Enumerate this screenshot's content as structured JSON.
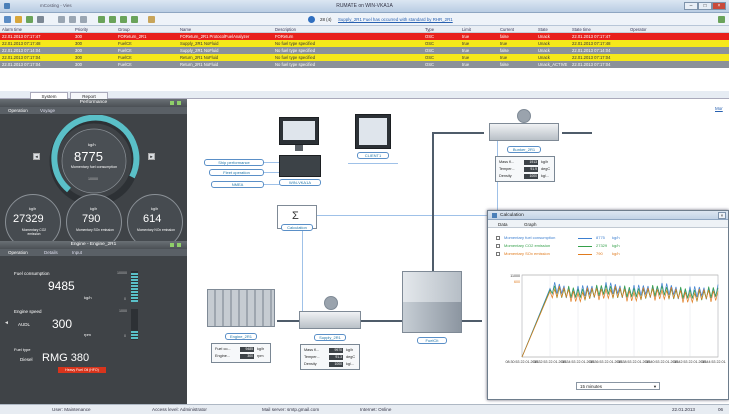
{
  "window": {
    "title": "RUMATE on WIN-VKA1A",
    "app_label": "mCosting - Vies"
  },
  "alarms": {
    "columns": [
      "Alarm time",
      "Priority",
      "Group",
      "Name",
      "Description",
      "Type",
      "Limit",
      "Current",
      "State",
      "State time",
      "Operator"
    ],
    "info_count": "28 (4)",
    "info_text": "Supply_2R1 Fuel has occurred with standard by RHR_2R1",
    "rows": [
      {
        "cells": [
          "22.01.2013 07:17:47",
          "300",
          "FOReturn_2R1",
          "FOReturn_2R1 ProtocolFuelAnalyzer",
          "FOReturn",
          "OSC",
          "true",
          "false",
          "Unack",
          "22.01.2013 07:17:47",
          ""
        ],
        "color": "#e8201c",
        "text": "#fff"
      },
      {
        "cells": [
          "22.01.2013 07:17:48",
          "300",
          "FuelCIt",
          "Supply_2R1 NoFluid",
          "No fuel type specified",
          "OSC",
          "true",
          "true",
          "Unack",
          "22.01.2013 07:17:48",
          ""
        ],
        "color": "#f5e81a",
        "text": "#333"
      },
      {
        "cells": [
          "22.01.2013 07:14:04",
          "300",
          "FuelCIt",
          "Supply_2R1 NoFluid",
          "No fuel type specified",
          "OSC",
          "true",
          "false",
          "Unack",
          "22.01.2013 07:14:04",
          ""
        ],
        "color": "#8b9199",
        "text": "#fff"
      },
      {
        "cells": [
          "22.01.2013 07:17:04",
          "300",
          "FuelCIt",
          "Return_2R1 NoFluid",
          "No fuel type specified",
          "OSC",
          "true",
          "true",
          "Unack",
          "22.01.2013 07:17:04",
          ""
        ],
        "color": "#f5e81a",
        "text": "#333"
      },
      {
        "cells": [
          "22.01.2013 07:17:04",
          "300",
          "FuelCIt",
          "Return_2R1 NoFluid",
          "No fuel type specified",
          "OSC",
          "true",
          "false",
          "Unack_ACTIVE",
          "22.01.2013 07:17:04",
          ""
        ],
        "color": "#8b9199",
        "text": "#fff"
      }
    ]
  },
  "tabs": [
    "System",
    "Report"
  ],
  "performance": {
    "title": "Performance",
    "subtabs": [
      "Operation",
      "Voyage"
    ],
    "center_unit": "kg/h",
    "center_value": "8775",
    "center_label": "Momentary fuel consumption",
    "gauge_max": "10000",
    "cards": [
      {
        "unit": "kg/h",
        "value": "27329",
        "label": "Momentary CO2 emission"
      },
      {
        "unit": "kg/h",
        "value": "790",
        "label": "Momentary SOx emission"
      },
      {
        "unit": "kg/h",
        "value": "614",
        "label": "Momentary NOx emission"
      }
    ]
  },
  "engine": {
    "title": "Engine - Engine_2R1",
    "subtabs": [
      "Operation",
      "Details",
      "Input"
    ],
    "fuel_label": "Fuel consumption",
    "fuel_value": "9485",
    "fuel_unit": "kg/h",
    "fuel_max": "10000",
    "fuel_min": "0",
    "speed_label": "Engine speed",
    "speed_mode": "AUDL",
    "speed_value": "300",
    "speed_unit": "rpm",
    "speed_max": "1000",
    "speed_min": "0",
    "fuel_type_label": "Fuel type",
    "fuel_class": "Diesel",
    "fuel_type": "RMG 380",
    "fuel_warning": "Heavy Fuel Oil (HFO)"
  },
  "diagram": {
    "labels": {
      "ship_performance": "Ship performance",
      "fleet_operation": "Fleet operation",
      "nmea": "NMEA",
      "server": "WIN-VKA1A",
      "client": "CLIENT1",
      "calculation": "Calculation",
      "bunker": "Bunker_2R1",
      "engine": "Engine_2R1",
      "supply": "Supply_2R1",
      "fueltank": "FuelCIt"
    },
    "sigma": "Σ",
    "bunker_readout": [
      {
        "label": "Mass fl...",
        "value": "1913",
        "unit": "kg/h"
      },
      {
        "label": "Temper...",
        "value": "91.9",
        "unit": "degC"
      },
      {
        "label": "Density",
        "value": "1000",
        "unit": "kg/..."
      }
    ],
    "engine_readout": [
      {
        "label": "Fuel co...",
        "value": "9485",
        "unit": "kg/h"
      },
      {
        "label": "Engine...",
        "value": "300",
        "unit": "rpm"
      }
    ],
    "supply_readout": [
      {
        "label": "Mass fl...",
        "value": "9970",
        "unit": "kg/h"
      },
      {
        "label": "Temper...",
        "value": "91.3",
        "unit": "degC"
      },
      {
        "label": "Density",
        "value": "1000",
        "unit": "kg/..."
      }
    ],
    "right_link": "Mor"
  },
  "calc_window": {
    "title": "Calculation",
    "tabs": [
      "Data",
      "Graph"
    ],
    "legend": [
      {
        "name": "Momentary fuel consumption",
        "value": "8775",
        "unit": "kg/h",
        "color": "#3c7fd0"
      },
      {
        "name": "Momentary CO2 emission",
        "value": "27329",
        "unit": "kg/h",
        "color": "#35a04a"
      },
      {
        "name": "Momentary SOx emission",
        "value": "790",
        "unit": "kg/h",
        "color": "#e07b1e"
      }
    ],
    "dropdown": "15 minutes",
    "y_ticks": [
      "11000",
      "600"
    ]
  },
  "chart_data": {
    "type": "line",
    "x": [
      "08:30:53 22.01.2013",
      "08:32:53 22.01.2013",
      "08:34:53 22.01.2013",
      "08:36:53 22.01.2013",
      "08:38:53 22.01.2013",
      "08:40:53 22.01.2013",
      "08:42:53 22.01.2013",
      "08:44:53 22.01.2013"
    ],
    "series": [
      {
        "name": "Momentary fuel consumption",
        "color": "#3c7fd0",
        "values": [
          0,
          9200,
          8600,
          9100,
          8700,
          9000,
          8500,
          8775
        ]
      },
      {
        "name": "Momentary CO2 emission",
        "color": "#35a04a",
        "values": [
          0,
          9000,
          8400,
          8900,
          8500,
          8800,
          8300,
          8600
        ]
      },
      {
        "name": "Momentary SOx emission",
        "color": "#e07b1e",
        "values": [
          0,
          8800,
          8200,
          8700,
          8300,
          8600,
          8100,
          8400
        ]
      }
    ],
    "ylim": [
      0,
      11000
    ]
  },
  "status": {
    "user": "User: Maintenance",
    "access": "Access level: Administrator",
    "mail": "Mail server: smtp.gmail.com",
    "internet": "Internet: Online",
    "date": "22.01.2013",
    "version": "06"
  }
}
